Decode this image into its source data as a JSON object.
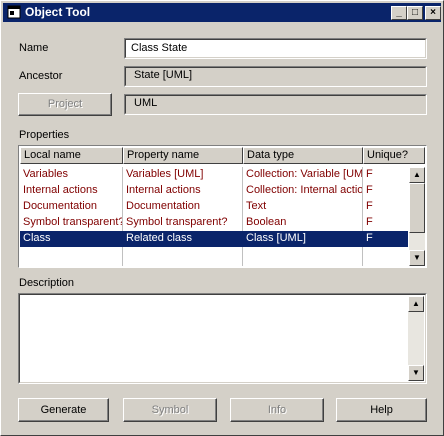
{
  "window": {
    "title": "Object Tool",
    "controls": {
      "minimize": "_",
      "maximize": "□",
      "close": "×"
    }
  },
  "form": {
    "name_label": "Name",
    "name_value": "Class State",
    "ancestor_label": "Ancestor",
    "ancestor_value": "State [UML]",
    "project_button": "Project",
    "project_value": "UML",
    "properties_label": "Properties",
    "description_label": "Description",
    "description_value": ""
  },
  "properties_table": {
    "columns": [
      "Local name",
      "Property name",
      "Data type",
      "Unique?"
    ],
    "rows": [
      {
        "local": "Variables",
        "property": "Variables [UML]",
        "type": "Collection: Variable [UML]",
        "unique": "F",
        "selected": false
      },
      {
        "local": "Internal actions",
        "property": "Internal actions",
        "type": "Collection: Internal actions",
        "unique": "F",
        "selected": false
      },
      {
        "local": "Documentation",
        "property": "Documentation",
        "type": "Text",
        "unique": "F",
        "selected": false
      },
      {
        "local": "Symbol transparent?",
        "property": "Symbol transparent?",
        "type": "Boolean",
        "unique": "F",
        "selected": false
      },
      {
        "local": "Class",
        "property": "Related class",
        "type": "Class [UML]",
        "unique": "F",
        "selected": true
      }
    ]
  },
  "buttons": {
    "generate": "Generate",
    "symbol": "Symbol",
    "info": "Info",
    "help": "Help"
  },
  "scroll": {
    "up": "▲",
    "down": "▼"
  },
  "colors": {
    "titlebar": "#0a246a",
    "row_text": "#800000",
    "selection": "#0a246a"
  }
}
